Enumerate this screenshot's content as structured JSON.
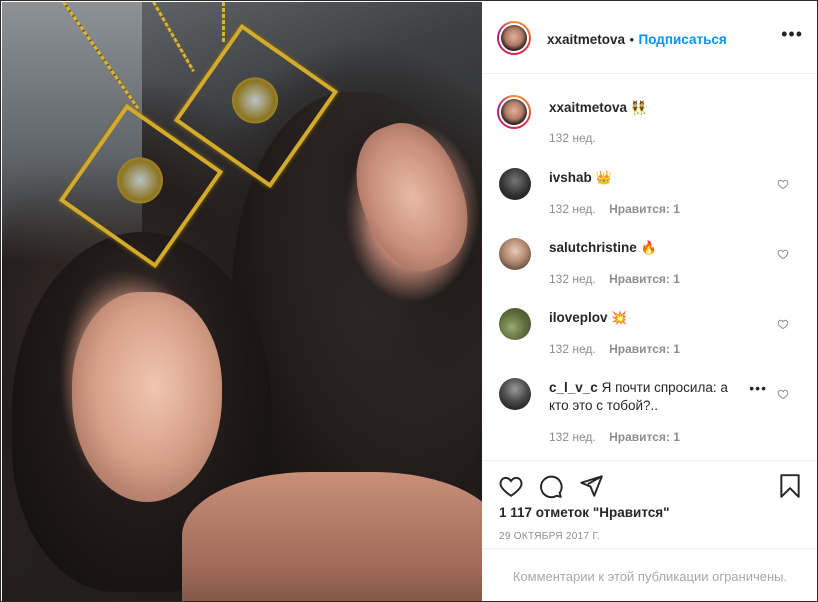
{
  "post": {
    "author": "xxaitmetova",
    "separator": "•",
    "follow_label": "Подписаться",
    "more_label": "•••"
  },
  "caption": {
    "username": "xxaitmetova",
    "emoji": "👯",
    "time": "132 нед."
  },
  "comments": [
    {
      "username": "ivshab",
      "text": "",
      "emoji": "👑",
      "time": "132 нед.",
      "likes": "Нравится: 1"
    },
    {
      "username": "salutchristine",
      "text": "",
      "emoji": "🔥",
      "time": "132 нед.",
      "likes": "Нравится: 1"
    },
    {
      "username": "iloveplov",
      "text": "",
      "emoji": "💥",
      "time": "132 нед.",
      "likes": "Нравится: 1"
    },
    {
      "username": "c_l_v_c",
      "text": "Я почти спросила: а кто это с тобой?..",
      "emoji": "",
      "time": "132 нед.",
      "likes": "Нравится: 1"
    }
  ],
  "actions": {
    "likes_count": "1 117 отметок \"Нравится\"",
    "date": "29 ОКТЯБРЯ 2017 Г."
  },
  "footer": {
    "limited_text": "Комментарии к этой публикации ограничены."
  },
  "icons": [
    "heart-icon",
    "comment-icon",
    "share-icon",
    "bookmark-icon",
    "more-options-icon"
  ],
  "colors": {
    "follow_blue": "#0095f6",
    "text_dark": "#262626",
    "text_muted": "#8e8e8e"
  }
}
